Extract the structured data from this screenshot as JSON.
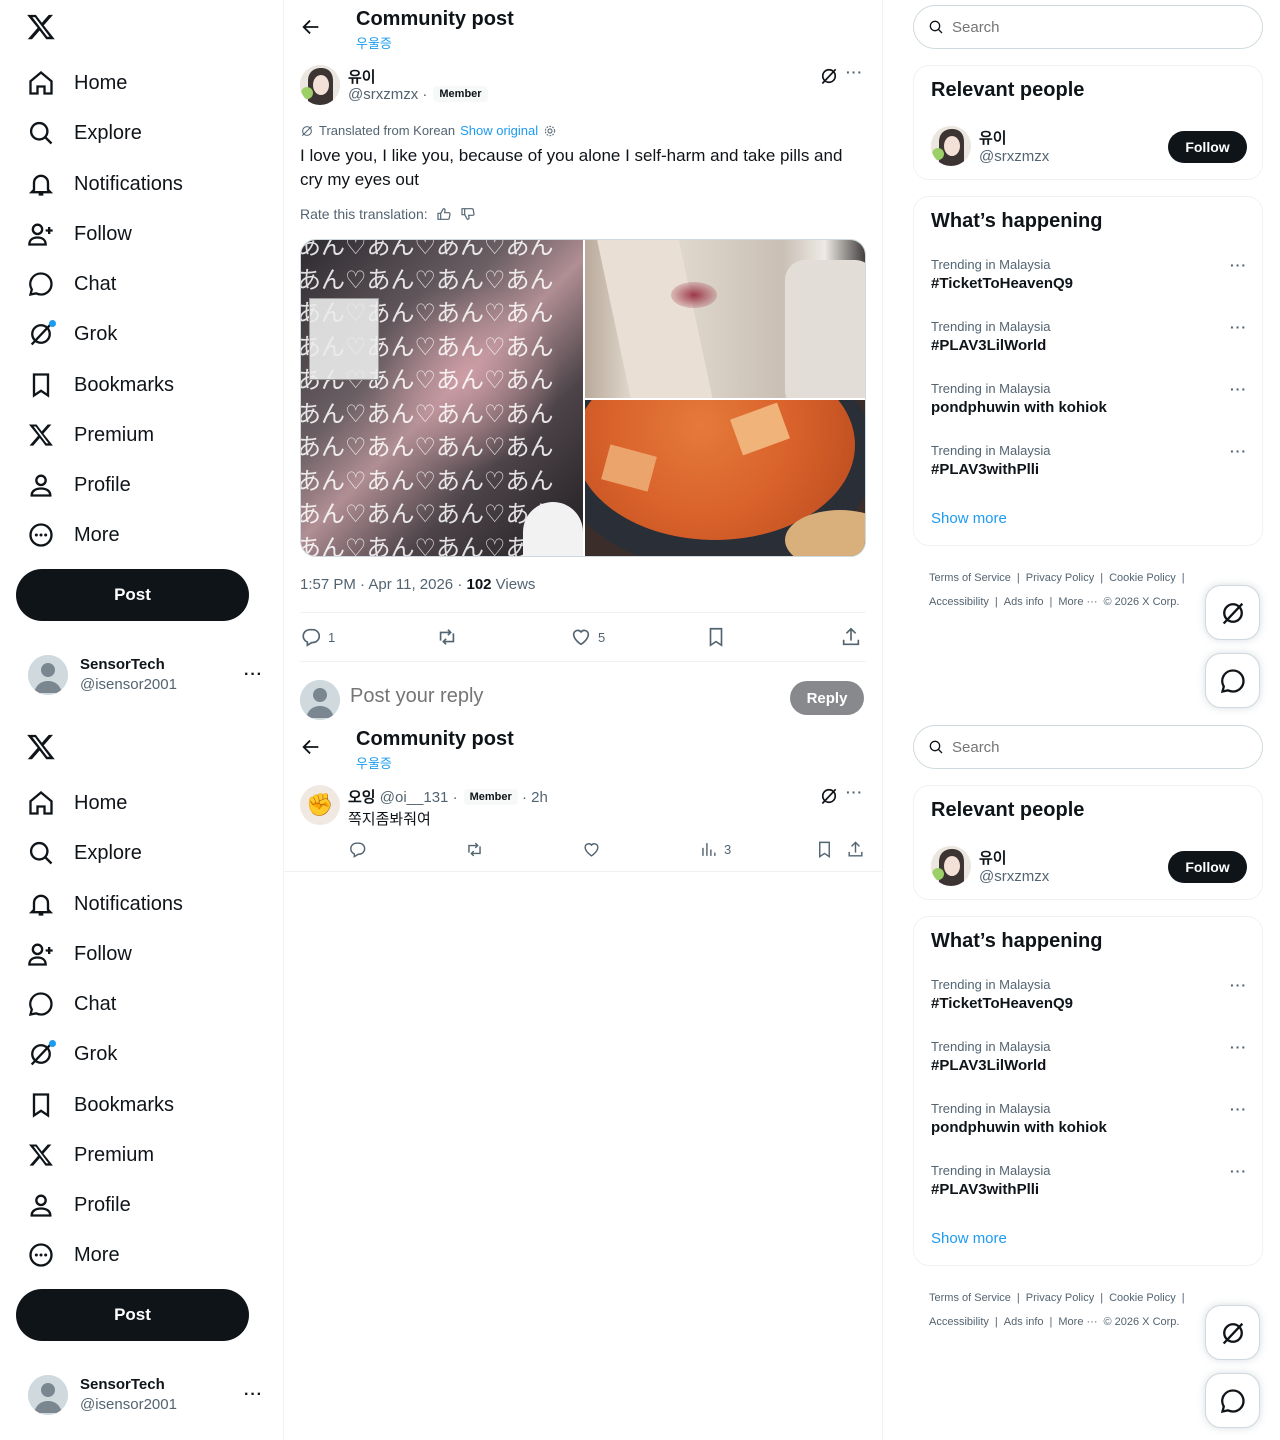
{
  "nav": {
    "items": [
      {
        "label": "Home",
        "icon": "home-icon"
      },
      {
        "label": "Explore",
        "icon": "search-icon"
      },
      {
        "label": "Notifications",
        "icon": "bell-icon"
      },
      {
        "label": "Follow",
        "icon": "person-plus-icon"
      },
      {
        "label": "Chat",
        "icon": "chat-icon"
      },
      {
        "label": "Grok",
        "icon": "grok-icon"
      },
      {
        "label": "Bookmarks",
        "icon": "bookmark-icon"
      },
      {
        "label": "Premium",
        "icon": "x-logo-icon"
      },
      {
        "label": "Profile",
        "icon": "person-icon"
      },
      {
        "label": "More",
        "icon": "more-circle-icon"
      }
    ],
    "post_label": "Post"
  },
  "account": {
    "name": "SensorTech",
    "handle": "@isensor2001"
  },
  "header": {
    "title": "Community post",
    "subtitle": "우울증"
  },
  "post": {
    "author_name": "유이",
    "author_handle": "@srxzmzx",
    "separator": "·",
    "badge": "Member",
    "translated_label": "Translated from Korean",
    "show_original": "Show original",
    "text": "I love you, I like you, because of you alone I self-harm and take pills and cry my eyes out",
    "rate_label": "Rate this translation:",
    "image_pattern_text": "あん♡あん♡あん♡あん",
    "time": "1:57 PM · Apr 11, 2026 · ",
    "views": "102",
    "views_label": " Views",
    "replies": "1",
    "likes": "5"
  },
  "reply": {
    "placeholder": "Post your reply",
    "button": "Reply"
  },
  "comment": {
    "avatar_emoji": "✊",
    "author_name": "오잉",
    "author_handle": "@oi__131",
    "separator": "·",
    "badge": "Member",
    "time": "· 2h",
    "text": "쪽지좀봐줘여",
    "views": "3"
  },
  "right": {
    "search_placeholder": "Search",
    "relevant_title": "Relevant people",
    "person": {
      "name": "유이",
      "handle": "@srxzmzx",
      "follow": "Follow"
    },
    "happening_title": "What’s happening",
    "trends": [
      {
        "context": "Trending in Malaysia",
        "title": "#TicketToHeavenQ9"
      },
      {
        "context": "Trending in Malaysia",
        "title": "#PLAV3LilWorld"
      },
      {
        "context": "Trending in Malaysia",
        "title": "pondphuwin with kohiok"
      },
      {
        "context": "Trending in Malaysia",
        "title": "#PLAV3withPlli"
      }
    ],
    "show_more": "Show more",
    "footer": [
      "Terms of Service",
      "|",
      "Privacy Policy",
      "|",
      "Cookie Policy",
      "|",
      "Accessibility",
      "|",
      "Ads info",
      "|",
      "More ···",
      "© 2026 X Corp."
    ]
  },
  "colors": {
    "accent": "#1d9bf0",
    "text": "#0f1419",
    "muted": "#536471",
    "border": "#eff3f4"
  }
}
